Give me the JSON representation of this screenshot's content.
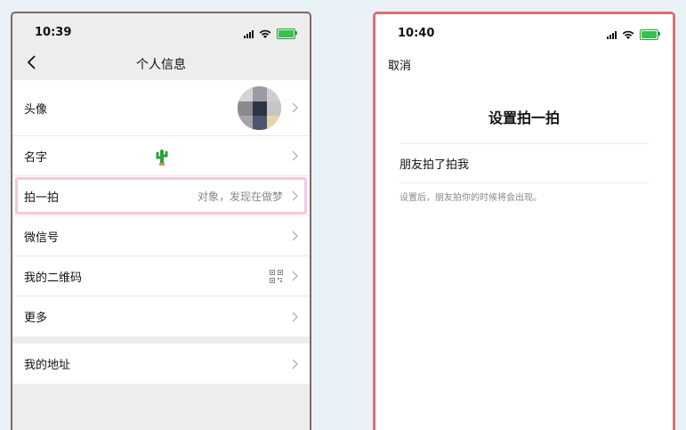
{
  "left": {
    "status": {
      "time": "10:39"
    },
    "nav": {
      "title": "个人信息"
    },
    "rows": [
      {
        "label": "头像"
      },
      {
        "label": "名字"
      },
      {
        "label": "拍一拍",
        "value": "对象，发现在做梦"
      },
      {
        "label": "微信号"
      },
      {
        "label": "我的二维码"
      },
      {
        "label": "更多"
      }
    ],
    "address_row": {
      "label": "我的地址"
    }
  },
  "right": {
    "status": {
      "time": "10:40"
    },
    "nav": {
      "cancel": "取消"
    },
    "title": "设置拍一拍",
    "field": "朋友拍了拍我",
    "hint": "设置后，朋友拍你的时候将会出现。"
  },
  "colors": {
    "highlight_border": "#f2c9df",
    "right_phone_border": "#dc6f73",
    "battery": "#36c24d"
  },
  "icons": [
    "back-icon",
    "chevron-right-icon",
    "cactus-icon",
    "qr-code-icon",
    "signal-icon",
    "wifi-icon",
    "battery-icon"
  ]
}
